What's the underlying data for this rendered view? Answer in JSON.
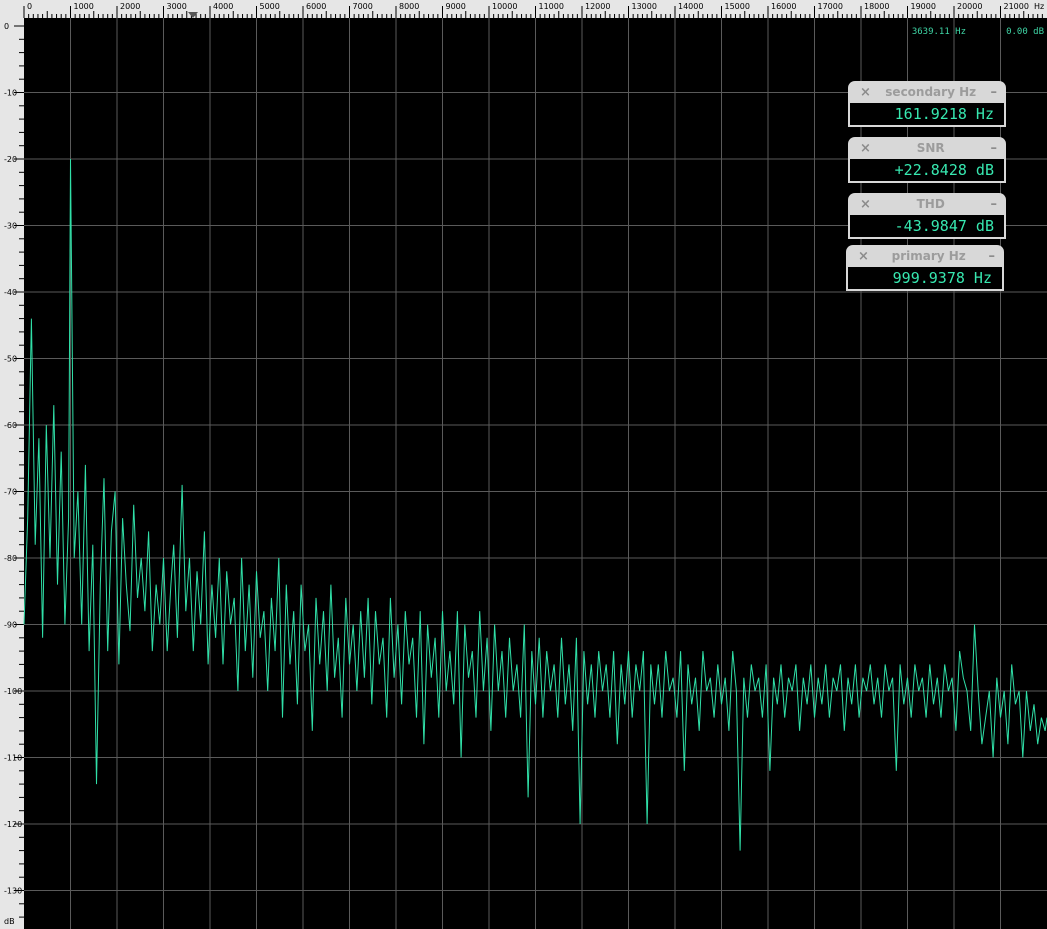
{
  "colors": {
    "background": "#000000",
    "ruler": "#e6e6e6",
    "grid": "#5a5a5a",
    "spectrum": "#30e0a8",
    "readout": "#3fd6a6"
  },
  "readout": {
    "frequency": "3639.11 Hz",
    "level": "0.00 dB"
  },
  "meters": [
    {
      "title": "secondary Hz",
      "value": "161.9218 Hz"
    },
    {
      "title": "SNR",
      "value": "+22.8428 dB"
    },
    {
      "title": "THD",
      "value": "-43.9847 dB"
    },
    {
      "title": "primary Hz",
      "value": "999.9378 Hz"
    }
  ],
  "meter_close_glyph": "×",
  "meter_min_glyph": "–",
  "chart_data": {
    "type": "line",
    "x_axis": {
      "unit_label": "Hz",
      "ticks": [
        0,
        1000,
        2000,
        3000,
        4000,
        5000,
        6000,
        7000,
        8000,
        9000,
        10000,
        11000,
        12000,
        13000,
        14000,
        15000,
        16000,
        17000,
        18000,
        19000,
        20000,
        21000
      ],
      "tick_labels": [
        "0",
        "1000",
        "2000",
        "3000",
        "4000",
        "5000",
        "6000",
        "7000",
        "8000",
        "9000",
        "10000",
        "11000",
        "12000",
        "13000",
        "14000",
        "15000",
        "16000",
        "17000",
        "18000",
        "19000",
        "20000",
        "21000"
      ],
      "range": [
        0,
        22050
      ]
    },
    "y_axis": {
      "unit_label": "dB",
      "ticks": [
        0,
        -10,
        -20,
        -30,
        -40,
        -50,
        -60,
        -70,
        -80,
        -90,
        -100,
        -110,
        -120,
        -130
      ],
      "tick_labels": [
        "0",
        "-10",
        "-20",
        "-30",
        "-40",
        "-50",
        "-60",
        "-70",
        "-80",
        "-90",
        "-100",
        "-110",
        "-120",
        "-130"
      ],
      "range": [
        -137,
        0
      ]
    },
    "grid": true,
    "marker_hz": 3639.11,
    "series": [
      {
        "points": [
          [
            0,
            -90
          ],
          [
            80,
            -74
          ],
          [
            160,
            -44
          ],
          [
            240,
            -78
          ],
          [
            320,
            -62
          ],
          [
            400,
            -92
          ],
          [
            480,
            -60
          ],
          [
            560,
            -80
          ],
          [
            640,
            -57
          ],
          [
            720,
            -84
          ],
          [
            800,
            -64
          ],
          [
            880,
            -90
          ],
          [
            960,
            -74
          ],
          [
            1000,
            -20
          ],
          [
            1080,
            -80
          ],
          [
            1160,
            -70
          ],
          [
            1240,
            -90
          ],
          [
            1320,
            -66
          ],
          [
            1400,
            -94
          ],
          [
            1480,
            -78
          ],
          [
            1560,
            -114
          ],
          [
            1640,
            -84
          ],
          [
            1720,
            -68
          ],
          [
            1800,
            -94
          ],
          [
            1880,
            -76
          ],
          [
            1960,
            -70
          ],
          [
            2040,
            -96
          ],
          [
            2120,
            -74
          ],
          [
            2200,
            -84
          ],
          [
            2280,
            -91
          ],
          [
            2360,
            -72
          ],
          [
            2440,
            -86
          ],
          [
            2520,
            -80
          ],
          [
            2600,
            -88
          ],
          [
            2680,
            -76
          ],
          [
            2760,
            -94
          ],
          [
            2840,
            -84
          ],
          [
            2920,
            -90
          ],
          [
            3000,
            -80
          ],
          [
            3080,
            -94
          ],
          [
            3160,
            -84
          ],
          [
            3220,
            -78
          ],
          [
            3300,
            -92
          ],
          [
            3400,
            -69
          ],
          [
            3480,
            -88
          ],
          [
            3560,
            -80
          ],
          [
            3640,
            -94
          ],
          [
            3720,
            -82
          ],
          [
            3800,
            -90
          ],
          [
            3880,
            -76
          ],
          [
            3960,
            -96
          ],
          [
            4040,
            -84
          ],
          [
            4120,
            -92
          ],
          [
            4200,
            -80
          ],
          [
            4280,
            -96
          ],
          [
            4360,
            -82
          ],
          [
            4440,
            -90
          ],
          [
            4520,
            -86
          ],
          [
            4600,
            -100
          ],
          [
            4680,
            -80
          ],
          [
            4760,
            -94
          ],
          [
            4840,
            -84
          ],
          [
            4920,
            -98
          ],
          [
            5000,
            -82
          ],
          [
            5080,
            -92
          ],
          [
            5160,
            -88
          ],
          [
            5240,
            -100
          ],
          [
            5320,
            -86
          ],
          [
            5400,
            -94
          ],
          [
            5480,
            -80
          ],
          [
            5560,
            -104
          ],
          [
            5640,
            -84
          ],
          [
            5720,
            -96
          ],
          [
            5800,
            -88
          ],
          [
            5880,
            -102
          ],
          [
            5960,
            -84
          ],
          [
            6040,
            -94
          ],
          [
            6120,
            -90
          ],
          [
            6200,
            -106
          ],
          [
            6280,
            -86
          ],
          [
            6360,
            -96
          ],
          [
            6440,
            -88
          ],
          [
            6520,
            -100
          ],
          [
            6600,
            -84
          ],
          [
            6680,
            -98
          ],
          [
            6760,
            -92
          ],
          [
            6840,
            -104
          ],
          [
            6920,
            -86
          ],
          [
            7000,
            -96
          ],
          [
            7080,
            -90
          ],
          [
            7160,
            -100
          ],
          [
            7240,
            -88
          ],
          [
            7320,
            -98
          ],
          [
            7400,
            -86
          ],
          [
            7480,
            -102
          ],
          [
            7560,
            -88
          ],
          [
            7640,
            -96
          ],
          [
            7720,
            -92
          ],
          [
            7800,
            -104
          ],
          [
            7880,
            -86
          ],
          [
            7960,
            -98
          ],
          [
            8040,
            -90
          ],
          [
            8120,
            -102
          ],
          [
            8200,
            -88
          ],
          [
            8280,
            -96
          ],
          [
            8360,
            -92
          ],
          [
            8440,
            -104
          ],
          [
            8520,
            -88
          ],
          [
            8600,
            -108
          ],
          [
            8680,
            -90
          ],
          [
            8760,
            -98
          ],
          [
            8840,
            -92
          ],
          [
            8920,
            -104
          ],
          [
            9000,
            -88
          ],
          [
            9080,
            -100
          ],
          [
            9160,
            -94
          ],
          [
            9240,
            -102
          ],
          [
            9320,
            -88
          ],
          [
            9400,
            -110
          ],
          [
            9480,
            -90
          ],
          [
            9560,
            -98
          ],
          [
            9640,
            -94
          ],
          [
            9720,
            -104
          ],
          [
            9800,
            -88
          ],
          [
            9880,
            -100
          ],
          [
            9960,
            -92
          ],
          [
            10040,
            -106
          ],
          [
            10120,
            -90
          ],
          [
            10200,
            -100
          ],
          [
            10280,
            -94
          ],
          [
            10360,
            -104
          ],
          [
            10440,
            -92
          ],
          [
            10520,
            -100
          ],
          [
            10600,
            -96
          ],
          [
            10680,
            -104
          ],
          [
            10760,
            -90
          ],
          [
            10840,
            -116
          ],
          [
            10920,
            -94
          ],
          [
            11000,
            -102
          ],
          [
            11080,
            -92
          ],
          [
            11160,
            -104
          ],
          [
            11240,
            -94
          ],
          [
            11320,
            -100
          ],
          [
            11400,
            -96
          ],
          [
            11480,
            -104
          ],
          [
            11560,
            -92
          ],
          [
            11640,
            -102
          ],
          [
            11720,
            -96
          ],
          [
            11800,
            -106
          ],
          [
            11880,
            -92
          ],
          [
            11960,
            -120
          ],
          [
            12040,
            -94
          ],
          [
            12120,
            -102
          ],
          [
            12200,
            -96
          ],
          [
            12280,
            -104
          ],
          [
            12360,
            -94
          ],
          [
            12440,
            -100
          ],
          [
            12520,
            -96
          ],
          [
            12600,
            -104
          ],
          [
            12680,
            -94
          ],
          [
            12760,
            -108
          ],
          [
            12840,
            -96
          ],
          [
            12920,
            -102
          ],
          [
            13000,
            -94
          ],
          [
            13080,
            -104
          ],
          [
            13160,
            -96
          ],
          [
            13240,
            -100
          ],
          [
            13320,
            -94
          ],
          [
            13400,
            -120
          ],
          [
            13480,
            -96
          ],
          [
            13560,
            -102
          ],
          [
            13640,
            -96
          ],
          [
            13720,
            -104
          ],
          [
            13800,
            -94
          ],
          [
            13880,
            -100
          ],
          [
            13960,
            -98
          ],
          [
            14040,
            -104
          ],
          [
            14120,
            -94
          ],
          [
            14200,
            -112
          ],
          [
            14280,
            -96
          ],
          [
            14360,
            -102
          ],
          [
            14440,
            -98
          ],
          [
            14520,
            -106
          ],
          [
            14600,
            -94
          ],
          [
            14680,
            -100
          ],
          [
            14760,
            -98
          ],
          [
            14840,
            -104
          ],
          [
            14920,
            -96
          ],
          [
            15000,
            -102
          ],
          [
            15080,
            -98
          ],
          [
            15160,
            -106
          ],
          [
            15240,
            -94
          ],
          [
            15320,
            -100
          ],
          [
            15400,
            -124
          ],
          [
            15480,
            -98
          ],
          [
            15560,
            -104
          ],
          [
            15640,
            -96
          ],
          [
            15720,
            -100
          ],
          [
            15800,
            -98
          ],
          [
            15880,
            -104
          ],
          [
            15960,
            -96
          ],
          [
            16040,
            -112
          ],
          [
            16120,
            -98
          ],
          [
            16200,
            -102
          ],
          [
            16280,
            -96
          ],
          [
            16360,
            -104
          ],
          [
            16440,
            -98
          ],
          [
            16520,
            -100
          ],
          [
            16600,
            -96
          ],
          [
            16680,
            -106
          ],
          [
            16760,
            -98
          ],
          [
            16840,
            -102
          ],
          [
            16920,
            -96
          ],
          [
            17000,
            -104
          ],
          [
            17080,
            -98
          ],
          [
            17160,
            -102
          ],
          [
            17240,
            -96
          ],
          [
            17320,
            -104
          ],
          [
            17400,
            -98
          ],
          [
            17480,
            -100
          ],
          [
            17560,
            -96
          ],
          [
            17640,
            -106
          ],
          [
            17720,
            -98
          ],
          [
            17800,
            -102
          ],
          [
            17880,
            -96
          ],
          [
            17960,
            -104
          ],
          [
            18040,
            -98
          ],
          [
            18120,
            -100
          ],
          [
            18200,
            -96
          ],
          [
            18280,
            -102
          ],
          [
            18360,
            -98
          ],
          [
            18440,
            -104
          ],
          [
            18520,
            -96
          ],
          [
            18600,
            -100
          ],
          [
            18680,
            -98
          ],
          [
            18760,
            -112
          ],
          [
            18840,
            -96
          ],
          [
            18920,
            -102
          ],
          [
            19000,
            -98
          ],
          [
            19080,
            -104
          ],
          [
            19160,
            -96
          ],
          [
            19240,
            -100
          ],
          [
            19320,
            -98
          ],
          [
            19400,
            -104
          ],
          [
            19480,
            -96
          ],
          [
            19560,
            -102
          ],
          [
            19640,
            -98
          ],
          [
            19720,
            -104
          ],
          [
            19800,
            -96
          ],
          [
            19880,
            -100
          ],
          [
            19960,
            -98
          ],
          [
            20040,
            -106
          ],
          [
            20120,
            -94
          ],
          [
            20200,
            -98
          ],
          [
            20280,
            -100
          ],
          [
            20360,
            -106
          ],
          [
            20440,
            -90
          ],
          [
            20520,
            -100
          ],
          [
            20600,
            -108
          ],
          [
            20680,
            -104
          ],
          [
            20760,
            -100
          ],
          [
            20840,
            -110
          ],
          [
            20920,
            -98
          ],
          [
            21000,
            -104
          ],
          [
            21080,
            -100
          ],
          [
            21160,
            -108
          ],
          [
            21240,
            -96
          ],
          [
            21320,
            -102
          ],
          [
            21400,
            -100
          ],
          [
            21480,
            -110
          ],
          [
            21560,
            -100
          ],
          [
            21640,
            -106
          ],
          [
            21720,
            -102
          ],
          [
            21800,
            -108
          ],
          [
            21880,
            -104
          ],
          [
            21960,
            -106
          ],
          [
            22050,
            -104
          ]
        ]
      }
    ]
  }
}
